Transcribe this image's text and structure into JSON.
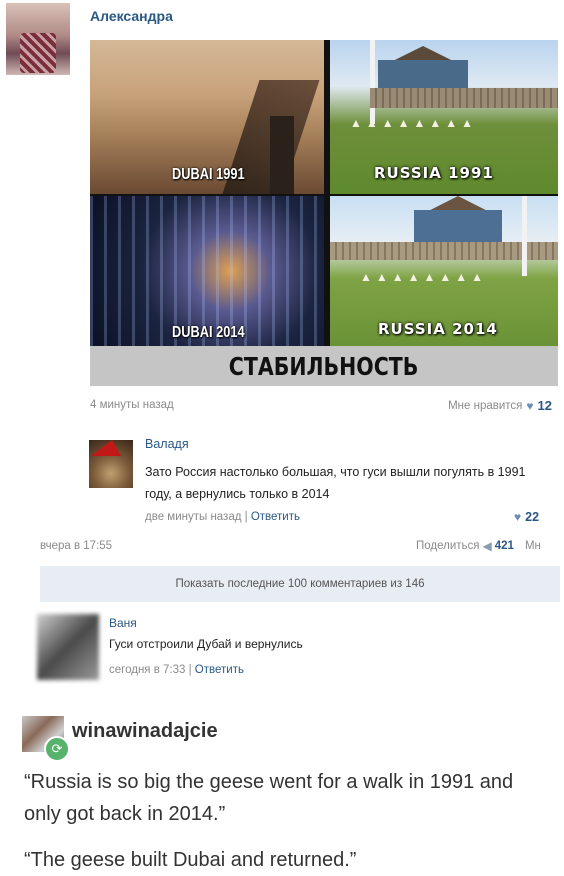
{
  "post": {
    "author": "Александра",
    "image": {
      "labels": {
        "dubai_1991": "DUBAI 1991",
        "russia_1991": "RUSSIA 1991",
        "dubai_2014": "DUBAI 2014",
        "russia_2014": "RUSSIA 2014"
      },
      "caption": "СТАБИЛЬНОСТЬ"
    },
    "time": "4 минуты назад",
    "like_label": "Мне нравится",
    "like_count": "12"
  },
  "comment": {
    "author": "Валадя",
    "text": "Зато Россия настолько большая, что гуси вышли погулять в 1991 году, а вернулись только в 2014",
    "time": "две минуты назад",
    "reply_label": "Ответить",
    "like_count": "22"
  },
  "repost": {
    "time": "вчера в 17:55",
    "share_label": "Поделиться",
    "share_count": "421",
    "more_label": "Мн"
  },
  "show_more": "Показать последние 100 комментариев из 146",
  "comment2": {
    "author": "Ваня",
    "text": "Гуси отстроили Дубай и вернулись",
    "time": "сегодня в 7:33",
    "reply_label": "Ответить"
  },
  "tumblr": {
    "username": "winawinadajcie",
    "quote1": "“Russia is so big the geese went for a walk in 1991 and only got back in 2014.”",
    "quote2": "“The geese built Dubai and returned.”"
  },
  "colors": {
    "link": "#2a5885",
    "show_more_bg": "#e8edf3",
    "reblog_green": "#57b36b"
  }
}
